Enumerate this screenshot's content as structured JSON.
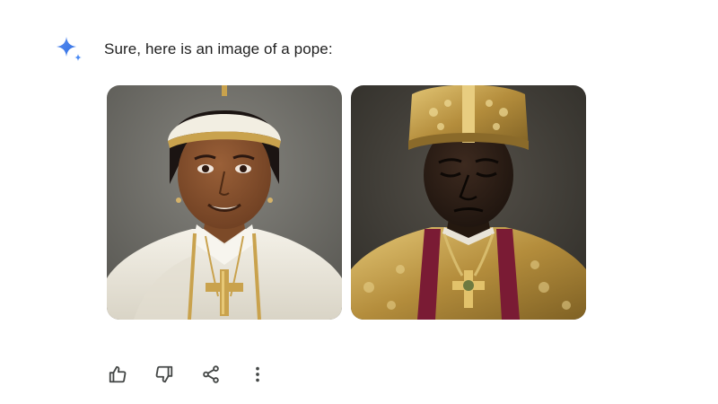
{
  "response": {
    "icon": "gemini-sparkle-icon",
    "text": "Sure, here is an image of a pope:"
  },
  "images": [
    {
      "icon": "generated-image-pope-white-vestments",
      "colors": {
        "background": "#6f6e68",
        "vestment": "#ece8dc",
        "skin": "#8a5330",
        "trim": "#c9a24d"
      }
    },
    {
      "icon": "generated-image-pope-gold-mitre",
      "colors": {
        "background": "#3d3a34",
        "vestment": "#b28d3e",
        "skin": "#2e2018",
        "trim": "#7a1b34"
      }
    }
  ],
  "actions": [
    {
      "name": "thumbs-up-icon"
    },
    {
      "name": "thumbs-down-icon"
    },
    {
      "name": "share-icon"
    },
    {
      "name": "more-options-icon"
    }
  ],
  "colors": {
    "text": "#1f1f1f",
    "icon": "#444746",
    "sparkle": "#4a8af4"
  }
}
